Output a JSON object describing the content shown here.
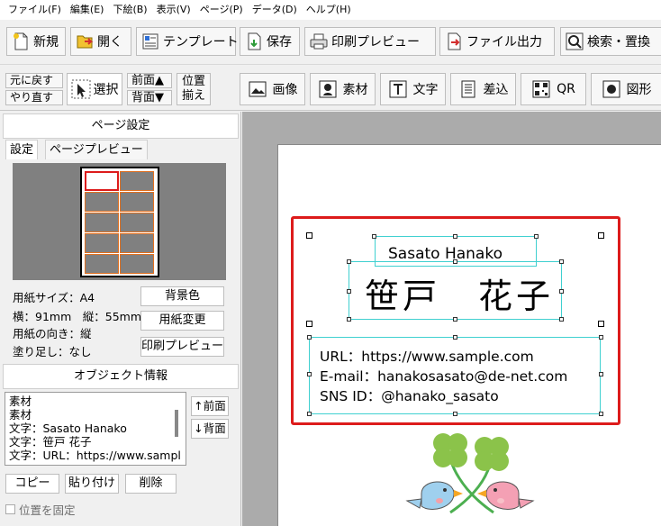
{
  "menu": [
    "ファイル(F)",
    "編集(E)",
    "下絵(B)",
    "表示(V)",
    "ページ(P)",
    "データ(D)",
    "ヘルプ(H)"
  ],
  "toolbar": {
    "new": "新規",
    "open": "開く",
    "template": "テンプレート",
    "save": "保存",
    "print_preview": "印刷プレビュー",
    "file_output": "ファイル出力",
    "search_replace": "検索・置換"
  },
  "toolbar2": {
    "undo": "元に戻す",
    "redo": "やり直す",
    "select": "選択",
    "front": "前面▲",
    "back": "背面▼",
    "align1": "位置",
    "align2": "揃え",
    "image": "画像",
    "material": "素材",
    "text": "文字",
    "merge": "差込",
    "qr": "QR",
    "shape": "図形"
  },
  "page_settings": {
    "title": "ページ設定",
    "tab_settings": "設定",
    "tab_preview": "ページプレビュー",
    "paper_size": "用紙サイズ：A4",
    "dimensions": "横：91mm　縦：55mm",
    "orientation": "用紙の向き：縦",
    "bleed": "塗り足し：なし",
    "bg_color_button": "背景色",
    "change_paper_button": "用紙変更",
    "print_preview_button": "印刷プレビュー"
  },
  "object_info": {
    "title": "オブジェクト情報",
    "items": [
      "素材",
      "素材",
      "文字：Sasato Hanako",
      "文字：笹戸 花子",
      "文字：URL：https://www.sampl"
    ],
    "front_button": "↑前面",
    "back_button": "↓背面",
    "copy_button": "コピー",
    "paste_button": "貼り付け",
    "delete_button": "削除",
    "lock_position": "位置を固定"
  },
  "card": {
    "name_roman": "Sasato Hanako",
    "name_kanji": "笹戸　花子",
    "url": "URL：https://www.sample.com",
    "email": "E-mail：hanakosasato@de-net.com",
    "sns": "SNS ID：@hanako_sasato"
  },
  "colors": {
    "card_border": "#dd1b1b",
    "selection_box": "#3fd0d0",
    "preview_grid": "#e07020"
  }
}
